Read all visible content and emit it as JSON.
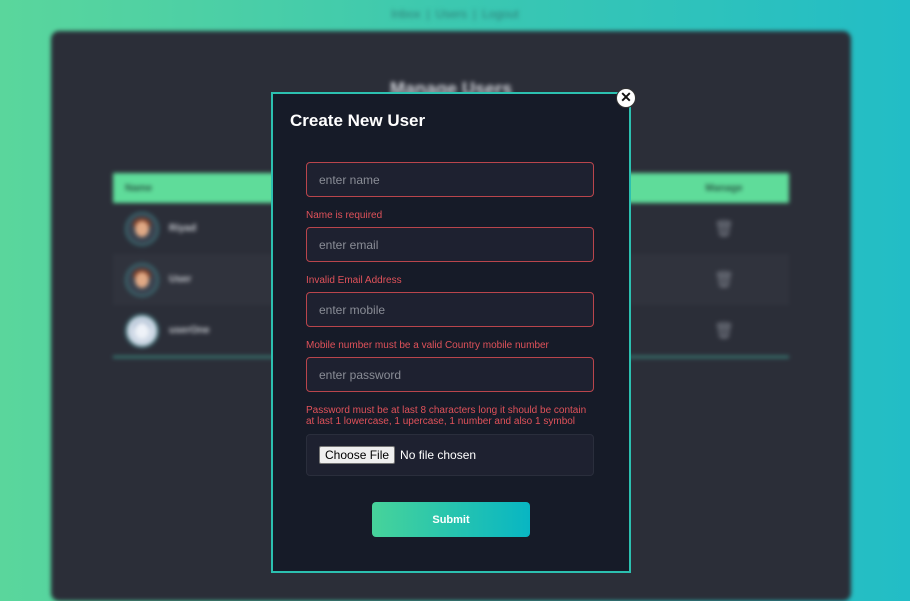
{
  "nav": {
    "inbox": "Inbox",
    "users": "Users",
    "logout": "Logout",
    "sep": "|"
  },
  "page": {
    "title": "Manage Users"
  },
  "table": {
    "col_name": "Name",
    "col_manage": "Manage",
    "rows": [
      {
        "name": "Riyad"
      },
      {
        "name": "User"
      },
      {
        "name": "userOne"
      }
    ]
  },
  "icons": {
    "trash": "trash-icon",
    "close": "close-icon"
  },
  "modal": {
    "title": "Create New User",
    "close_glyph": "✕",
    "name_placeholder": "enter name",
    "name_error": "Name is required",
    "email_placeholder": "enter email",
    "email_error": "Invalid Email Address",
    "mobile_placeholder": "enter mobile",
    "mobile_error": "Mobile number must be a valid Country mobile number",
    "password_placeholder": "enter password",
    "password_error": "Password must be at last 8 characters long it should be contain at last 1 lowercase, 1 upercase, 1 number and also 1 symbol",
    "file_button": "Choose File",
    "file_status": "No file chosen",
    "submit": "Submit"
  },
  "colors": {
    "accent_start": "#47d39a",
    "accent_end": "#08b6c3",
    "error": "#e0525a",
    "modal_bg": "#161b28"
  }
}
